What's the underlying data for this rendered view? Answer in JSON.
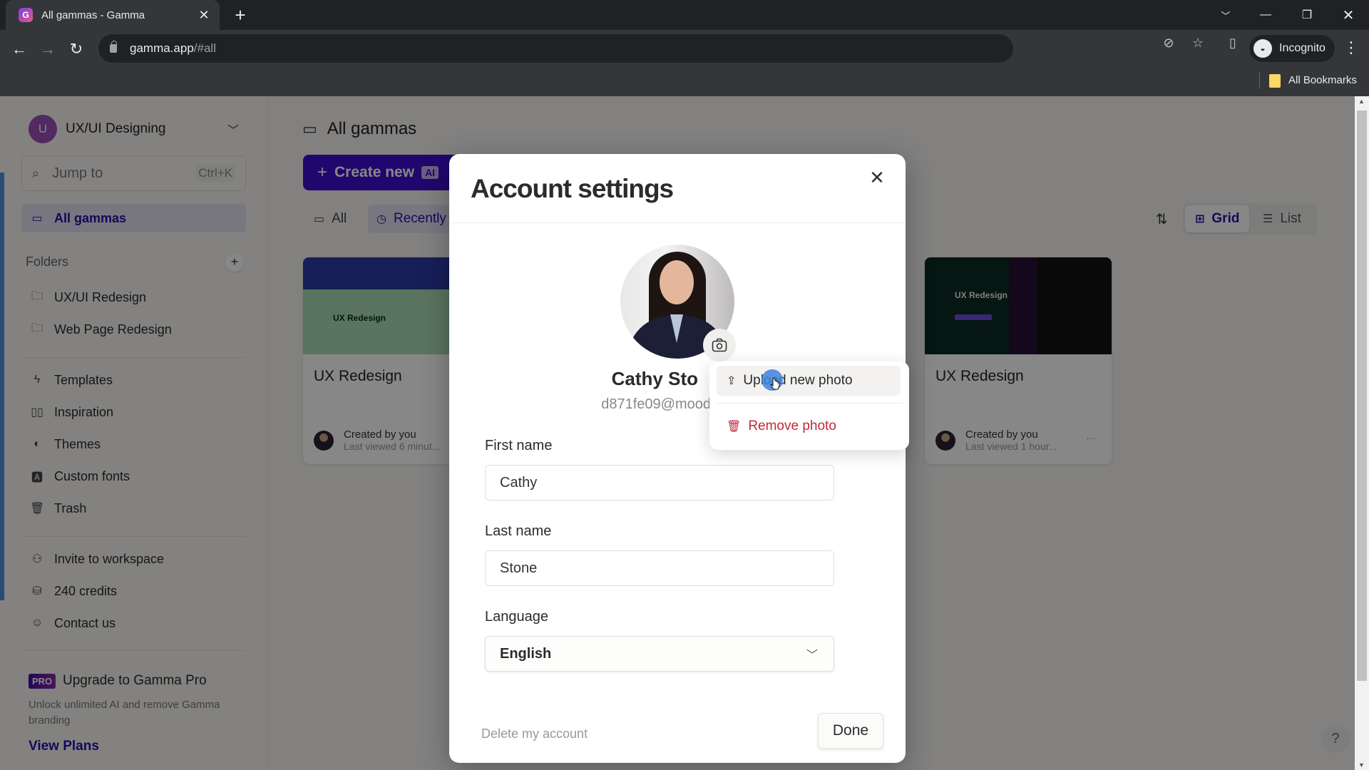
{
  "browser": {
    "tab_title": "All gammas - Gamma",
    "url_host": "gamma.app",
    "url_path": "/#all",
    "profile_label": "Incognito",
    "bookmarks_label": "All Bookmarks"
  },
  "sidebar": {
    "workspace_initial": "U",
    "workspace_name": "UX/UI Designing",
    "search_placeholder": "Jump to",
    "search_shortcut": "Ctrl+K",
    "all_gammas": "All gammas",
    "folders_label": "Folders",
    "folders": [
      {
        "label": "UX/UI Redesign",
        "icon": "folder-icon"
      },
      {
        "label": "Web Page Redesign",
        "icon": "folder-icon"
      }
    ],
    "links": [
      {
        "label": "Templates",
        "icon": "templates-icon"
      },
      {
        "label": "Inspiration",
        "icon": "book-open-icon"
      },
      {
        "label": "Themes",
        "icon": "palette-icon"
      },
      {
        "label": "Custom fonts",
        "icon": "font-book-icon"
      },
      {
        "label": "Trash",
        "icon": "trash-icon"
      }
    ],
    "secondary": [
      {
        "label": "Invite to workspace",
        "icon": "user-plus-icon"
      },
      {
        "label": "240 credits",
        "icon": "coins-icon"
      },
      {
        "label": "Contact us",
        "icon": "chat-icon"
      }
    ],
    "promo": {
      "badge": "PRO",
      "title": "Upgrade to Gamma Pro",
      "description": "Unlock unlimited AI and remove Gamma branding",
      "link": "View Plans"
    }
  },
  "main": {
    "title": "All gammas",
    "create_label": "Create new",
    "create_badge": "AI",
    "filters": [
      "All",
      "Recently"
    ],
    "view_options": [
      "Grid",
      "List"
    ],
    "cards": [
      {
        "thumb_title": "UX Redesign",
        "title": "UX Redesign",
        "created": "Created by you",
        "viewed": "Last viewed 6 minut..."
      },
      {
        "thumb_title": "UX Redesign",
        "title": "UX Redesign",
        "created": "Created by you",
        "viewed": "Last viewed 1 hour..."
      }
    ]
  },
  "modal": {
    "title": "Account settings",
    "full_name": "Cathy Sto",
    "email": "d871fe09@mood",
    "first_name_label": "First name",
    "first_name_value": "Cathy",
    "last_name_label": "Last name",
    "last_name_value": "Stone",
    "language_label": "Language",
    "language_value": "English",
    "delete_label": "Delete my account",
    "done_label": "Done"
  },
  "photo_menu": {
    "upload": "Upload new photo",
    "remove": "Remove photo"
  },
  "colors": {
    "brand": "#3c0fd0",
    "danger": "#c4283a",
    "accent_blue": "#4a90e2"
  }
}
